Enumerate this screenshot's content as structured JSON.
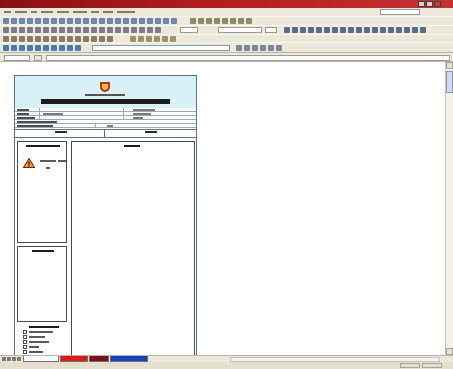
{
  "window": {
    "title": ""
  },
  "menu": {
    "items": [
      "",
      "",
      "",
      "",
      "",
      "",
      "",
      "",
      ""
    ]
  },
  "toolbar": {
    "font_name": "",
    "font_size": "",
    "zoom": "",
    "address": ""
  },
  "formula_bar": {
    "cell_reference": "",
    "content": ""
  },
  "form": {
    "organization": "",
    "title": "",
    "fields": [
      {
        "label": "",
        "value": "",
        "right_label": ""
      },
      {
        "label": "",
        "value": "",
        "right_label": ""
      },
      {
        "label": "",
        "value": "",
        "right_label": ""
      },
      {
        "label": "",
        "value": "",
        "right_label": ""
      },
      {
        "label": "",
        "value": "",
        "right_label": ""
      }
    ],
    "section_left": "",
    "section_right": "",
    "left_panel_title": "",
    "hazard_text": [
      "",
      "",
      ""
    ],
    "middle_panel_title": "",
    "main_panel_title": "",
    "legend_title": "",
    "legend_items": [
      "",
      "",
      "",
      "",
      ""
    ]
  },
  "sheets": [
    "",
    "",
    "",
    ""
  ],
  "status": {
    "text": ""
  },
  "colors": {
    "title_bar": "#b72020",
    "chrome": "#ece9d8",
    "form_header": "#d8f1f7",
    "form_border": "#5f6f7f",
    "sheet_tab_active": "#ffffff",
    "sheet_tab_red": "#e01818",
    "sheet_tab_maroon": "#7a1020",
    "sheet_tab_blue": "#1840c0"
  },
  "icons": {
    "logo": "badge-icon",
    "hazard": "warning-icon"
  }
}
